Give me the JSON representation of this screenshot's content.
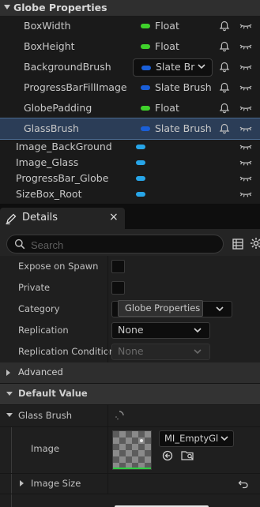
{
  "variables": {
    "category": "Globe Properties",
    "rows": [
      {
        "name": "BoxWidth",
        "type": "Float",
        "type_color": "#3fd12b"
      },
      {
        "name": "BoxHeight",
        "type": "Float",
        "type_color": "#3fd12b"
      },
      {
        "name": "BackgroundBrush",
        "type": "Slate Br",
        "type_color": "#1a5fd8",
        "editing": true
      },
      {
        "name": "ProgressBarFillImage",
        "type": "Slate Brush",
        "type_color": "#1a5fd8"
      },
      {
        "name": "GlobePadding",
        "type": "Float",
        "type_color": "#3fd12b"
      },
      {
        "name": "GlassBrush",
        "type": "Slate Brush",
        "type_color": "#1a5fd8",
        "selected": true
      }
    ],
    "widgets": [
      "Image_BackGround",
      "Image_Glass",
      "ProgressBar_Globe",
      "SizeBox_Root"
    ],
    "widget_pill_color": "#27a5e8",
    "selection_color": "#2b3d57"
  },
  "details": {
    "tab_label": "Details",
    "tab_close": "×",
    "search_placeholder": "Search",
    "properties": {
      "expose_on_spawn": "Expose on Spawn",
      "private": "Private",
      "category_label": "Category",
      "category_tooltip": "Globe Properties",
      "replication_label": "Replication",
      "replication_value": "None",
      "replication_condition_label": "Replication Condition",
      "replication_condition_value": "None"
    },
    "sections": {
      "advanced": "Advanced",
      "default_value": "Default Value"
    },
    "glass_brush": {
      "label": "Glass Brush",
      "image_label": "Image",
      "image_asset": "MI_EmptyGl",
      "image_size_label": "Image Size"
    }
  }
}
